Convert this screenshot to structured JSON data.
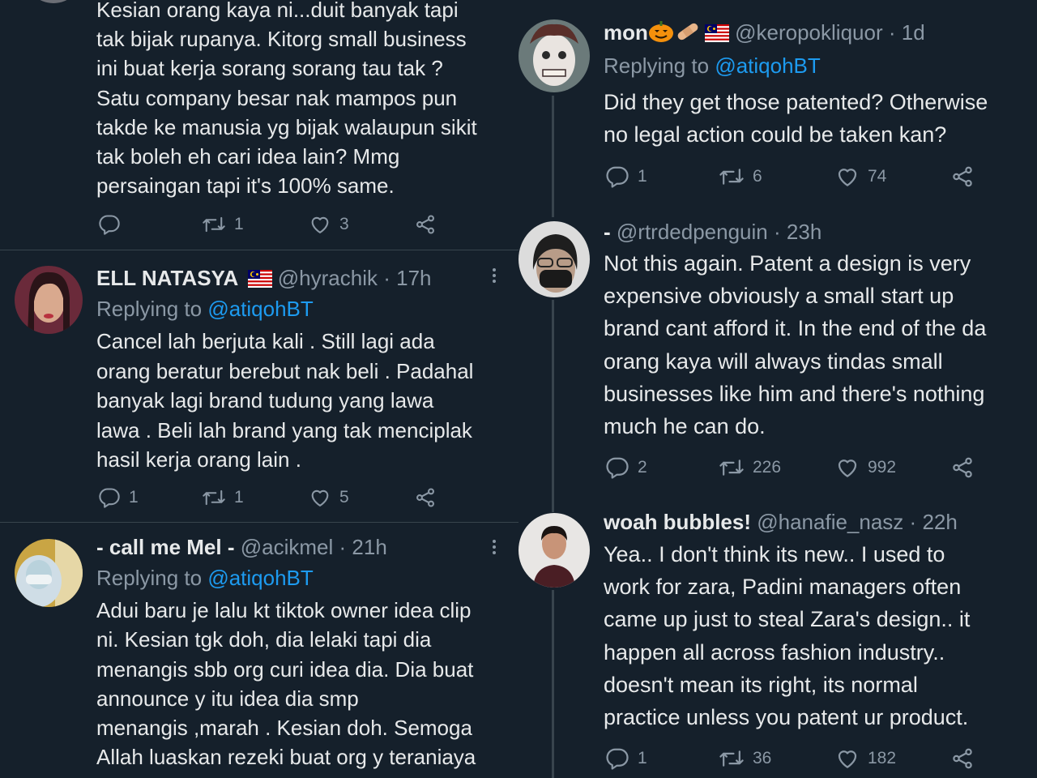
{
  "left": {
    "tweets": [
      {
        "text": "Kesian orang kaya ni...duit banyak tapi\ntak bijak rupanya. Kitorg small business\nini buat kerja sorang sorang tau tak ?\nSatu company besar nak mampos pun\ntakde ke manusia yg bijak walaupun sikit\ntak boleh eh cari idea lain? Mmg\npersaingan tapi it's 100% same.",
        "stats": {
          "replies": "",
          "retweets": "1",
          "likes": "3"
        }
      },
      {
        "name": "ELL NATASYA",
        "handle": "@hyrachik",
        "dot": "·",
        "time": "17h",
        "replying_prefix": "Replying to",
        "replying_to": "@atiqohBT",
        "text": "Cancel lah berjuta kali . Still lagi ada\norang beratur berebut nak beli . Padahal\nbanyak lagi brand tudung yang lawa\nlawa . Beli lah brand yang tak menciplak\nhasil kerja orang lain .",
        "stats": {
          "replies": "1",
          "retweets": "1",
          "likes": "5"
        }
      },
      {
        "name": "- call me Mel -",
        "handle": "@acikmel",
        "dot": "·",
        "time": "21h",
        "replying_prefix": "Replying to",
        "replying_to": "@atiqohBT",
        "text": "Adui baru je lalu kt tiktok owner idea clip\nni. Kesian tgk doh, dia lelaki tapi dia\nmenangis sbb org curi idea dia. Dia buat\nannounce y itu idea dia smp\nmenangis ,marah . Kesian doh. Semoga\nAllah luaskan rezeki buat org y teraniaya"
      }
    ]
  },
  "right": {
    "tweets": [
      {
        "name": "mon",
        "handle": "@keropokliquor",
        "dot": "·",
        "time": "1d",
        "replying_prefix": "Replying to",
        "replying_to": "@atiqohBT",
        "text": "Did they get those patented? Otherwise\nno legal action could be taken kan?",
        "stats": {
          "replies": "1",
          "retweets": "6",
          "likes": "74"
        }
      },
      {
        "name": "-",
        "handle": "@rtrdedpenguin",
        "dot": "·",
        "time": "23h",
        "text": "Not this again. Patent a design is very\nexpensive obviously a small start up\nbrand cant afford it. In the end of the da\norang kaya will always tindas small\nbusinesses like him and there's nothing\nmuch he can do.",
        "stats": {
          "replies": "2",
          "retweets": "226",
          "likes": "992"
        }
      },
      {
        "name": "woah bubbles!",
        "handle": "@hanafie_nasz",
        "dot": "·",
        "time": "22h",
        "text": "Yea.. I don't think its new.. I used to\nwork for zara, Padini managers often\ncame up just to steal Zara's design.. it\nhappen all across fashion industry..\ndoesn't mean its right, its normal\npractice unless you patent ur product.",
        "stats": {
          "replies": "1",
          "retweets": "36",
          "likes": "182"
        }
      }
    ]
  },
  "colors": {
    "background": "#15202b",
    "text": "#e7e9ea",
    "muted": "#8b98a5",
    "link": "#1d9bf0",
    "divider": "#38444d"
  },
  "icons": [
    "reply-icon",
    "retweet-icon",
    "like-icon",
    "share-icon",
    "more-icon",
    "malaysia-flag-icon",
    "pumpkin-emoji-icon",
    "bandage-emoji-icon"
  ]
}
